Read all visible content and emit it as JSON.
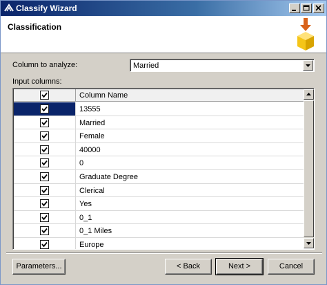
{
  "window": {
    "title": "Classify Wizard"
  },
  "header": {
    "title": "Classification"
  },
  "form": {
    "column_label": "Column to analyze:",
    "column_value": "Married",
    "input_label": "Input columns:"
  },
  "grid": {
    "column_header": "Column Name",
    "header_checked": true,
    "rows": [
      {
        "name": "13555",
        "checked": true
      },
      {
        "name": "Married",
        "checked": true
      },
      {
        "name": "Female",
        "checked": true
      },
      {
        "name": "40000",
        "checked": true
      },
      {
        "name": "0",
        "checked": true
      },
      {
        "name": "Graduate Degree",
        "checked": true
      },
      {
        "name": "Clerical",
        "checked": true
      },
      {
        "name": "Yes",
        "checked": true
      },
      {
        "name": "0_1",
        "checked": true
      },
      {
        "name": "0_1 Miles",
        "checked": true
      },
      {
        "name": "Europe",
        "checked": true
      }
    ]
  },
  "buttons": {
    "parameters": "Parameters...",
    "back": "< Back",
    "next": "Next >",
    "cancel": "Cancel"
  },
  "colors": {
    "title_gradient_start": "#0a246a",
    "selection": "#0a246a",
    "icon_arrow": "#d9621a",
    "icon_box": "#f5c518"
  }
}
